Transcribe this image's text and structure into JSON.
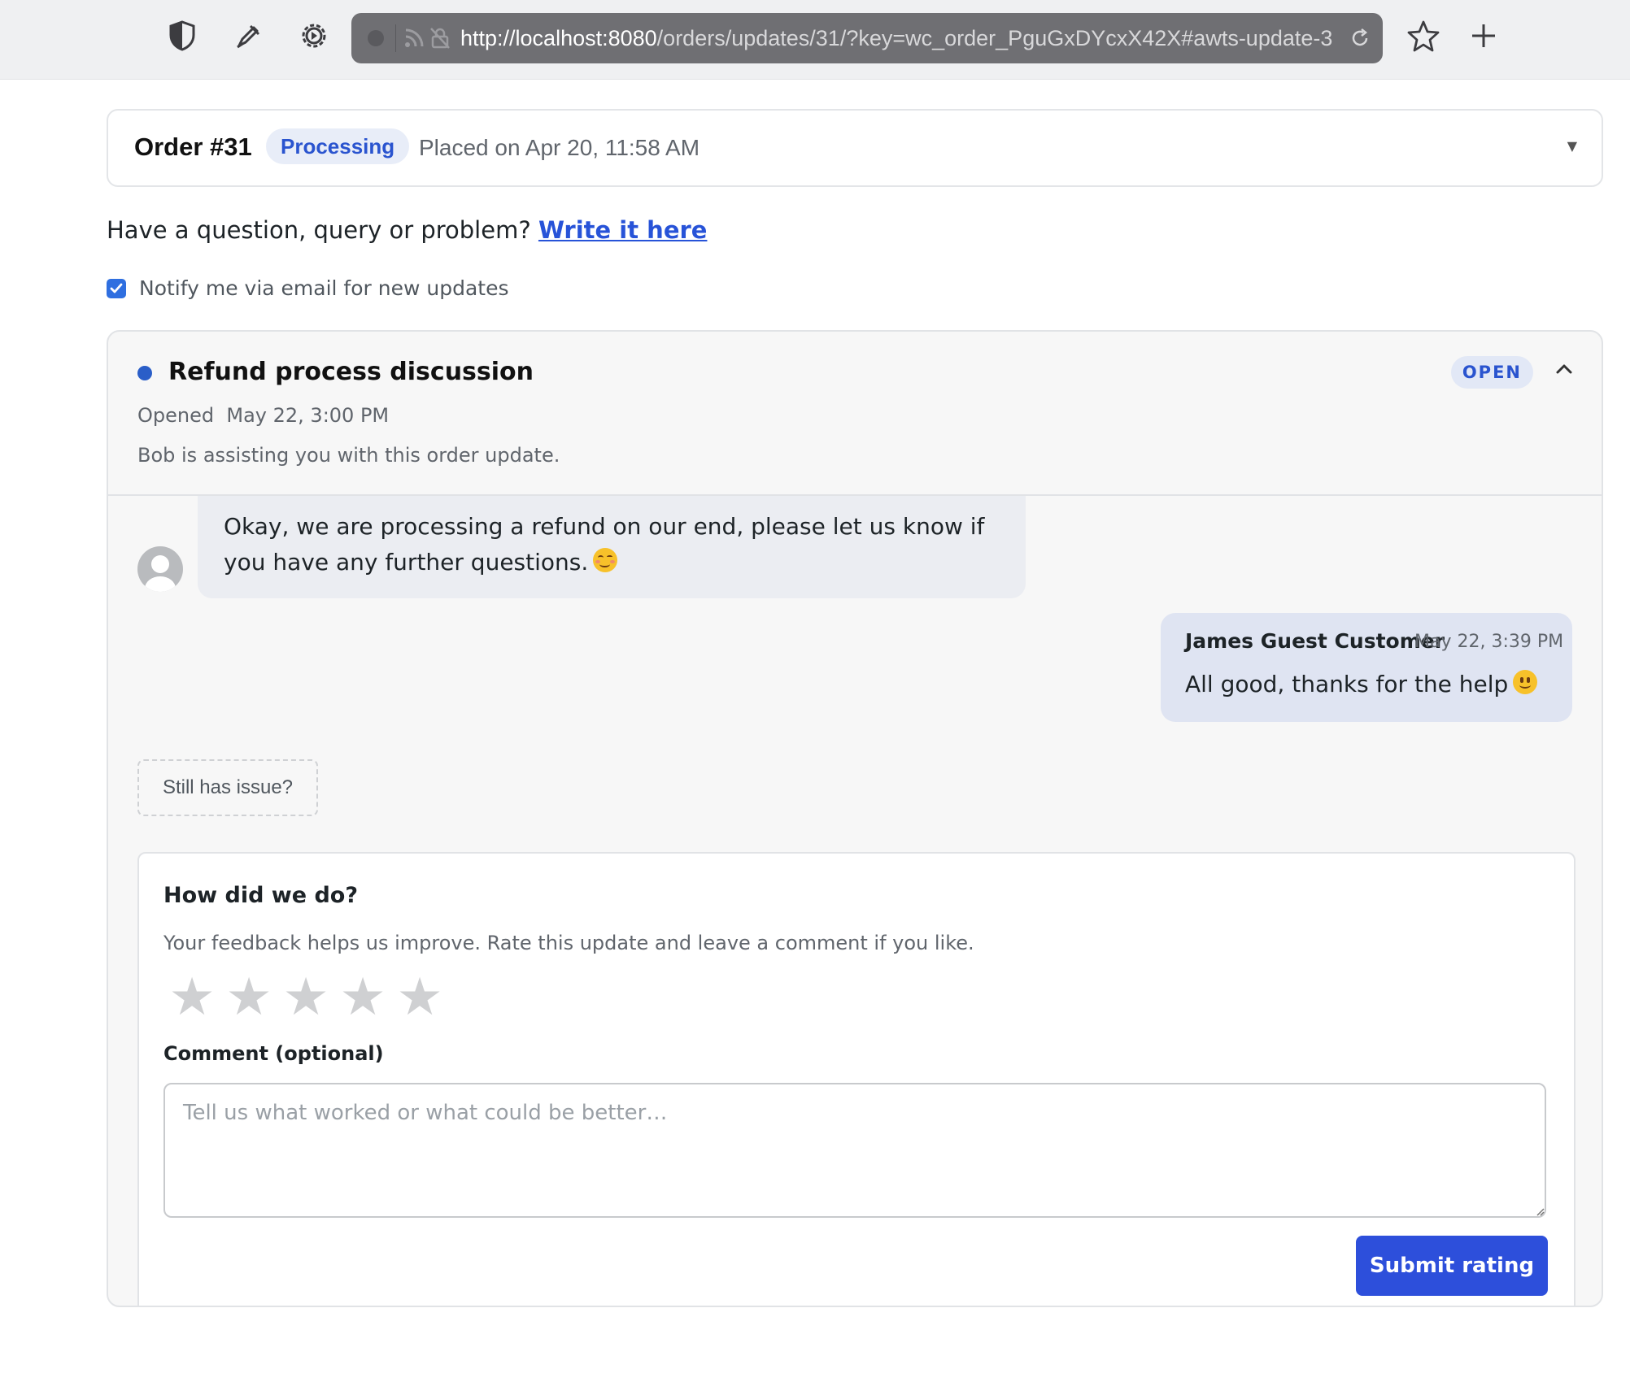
{
  "browser": {
    "url_host": "http://localhost:8080",
    "url_path": "/orders/updates/31/?key=wc_order_PguGxDYcxX42X#awts-update-3",
    "icons": [
      "shield-icon",
      "pen-icon",
      "gear-icon",
      "feed-icon",
      "lock-slash-icon",
      "reload-icon",
      "star-bookmark-icon",
      "plus-icon"
    ]
  },
  "order": {
    "title": "Order #31",
    "status": "Processing",
    "placed": "Placed on Apr 20, 11:58 AM"
  },
  "question": {
    "text": "Have a question, query or problem?",
    "link": "Write it here"
  },
  "notify": {
    "label": "Notify me via email for new updates",
    "checked": true
  },
  "thread": {
    "title": "Refund process discussion",
    "status": "OPEN",
    "opened_label": "Opened",
    "opened_date": "May 22, 3:00 PM",
    "assist": "Bob is assisting you with this order update.",
    "messages": [
      {
        "text": "Okay, we are processing a refund on our end, please let us know if you have any further questions.",
        "emoji": "blush-smile-emoji"
      },
      {
        "author": "James Guest Customer",
        "time": "May 22, 3:39 PM",
        "text": "All good, thanks for the help",
        "emoji": "slight-smile-emoji"
      }
    ],
    "still_issue": "Still has issue?"
  },
  "rating": {
    "title": "How did we do?",
    "subtitle": "Your feedback helps us improve. Rate this update and leave a comment if you like.",
    "stars": [
      "★",
      "★",
      "★",
      "★",
      "★"
    ],
    "stars_value": 0,
    "comment_label": "Comment (optional)",
    "comment_placeholder": "Tell us what worked or what could be better…",
    "comment_value": "",
    "submit": "Submit rating"
  },
  "colors": {
    "accent": "#2d4fdb",
    "link": "#2753d8",
    "badge_bg": "#e8edf8",
    "star_empty": "#cfd0d2"
  }
}
